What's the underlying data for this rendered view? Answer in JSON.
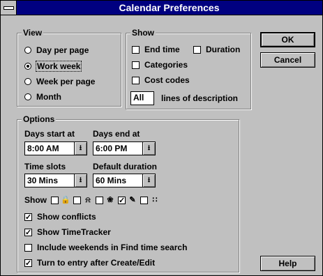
{
  "window": {
    "title": "Calendar Preferences"
  },
  "buttons": {
    "ok": "OK",
    "cancel": "Cancel",
    "help": "Help"
  },
  "view": {
    "label": "View",
    "options": [
      {
        "label": "Day per page",
        "selected": false
      },
      {
        "label": "Work week",
        "selected": true
      },
      {
        "label": "Week per page",
        "selected": false
      },
      {
        "label": "Month",
        "selected": false
      }
    ]
  },
  "show": {
    "label": "Show",
    "end_time": {
      "label": "End time",
      "checked": false
    },
    "duration": {
      "label": "Duration",
      "checked": false
    },
    "categories": {
      "label": "Categories",
      "checked": false
    },
    "cost_codes": {
      "label": "Cost codes",
      "checked": false
    },
    "lines_value": "All",
    "lines_label": "lines of description"
  },
  "options": {
    "label": "Options",
    "days_start_label": "Days start at",
    "days_start_value": "8:00 AM",
    "days_end_label": "Days end at",
    "days_end_value": "6:00 PM",
    "time_slots_label": "Time slots",
    "time_slots_value": "30 Mins",
    "default_duration_label": "Default duration",
    "default_duration_value": "60 Mins",
    "show_icons_label": "Show",
    "icons": [
      {
        "name": "lock-icon",
        "glyph": "🔒",
        "checked": false
      },
      {
        "name": "bell-icon",
        "glyph": "⍾",
        "checked": false
      },
      {
        "name": "recurring-icon",
        "glyph": "❀",
        "checked": false
      },
      {
        "name": "pencil-icon",
        "glyph": "✎",
        "checked": true
      },
      {
        "name": "dots-icon",
        "glyph": "∷",
        "checked": false
      }
    ],
    "checkboxes": [
      {
        "label": "Show conflicts",
        "checked": true
      },
      {
        "label": "Show TimeTracker",
        "checked": true
      },
      {
        "label": "Include weekends in Find time search",
        "checked": false
      },
      {
        "label": "Turn to entry after Create/Edit",
        "checked": true
      }
    ]
  }
}
